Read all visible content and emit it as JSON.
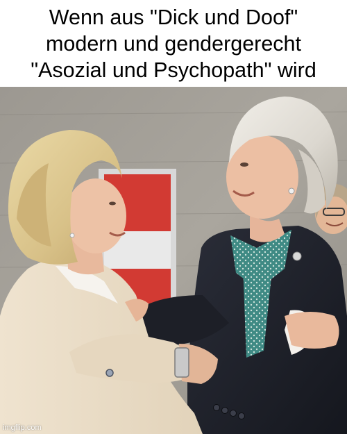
{
  "caption": {
    "lines": [
      "Wenn aus \"Dick und Doof\"",
      "modern und gendergerecht",
      "\"Asozial und Psychopath\" wird"
    ]
  },
  "photo": {
    "watermark": "imgflip.com"
  }
}
